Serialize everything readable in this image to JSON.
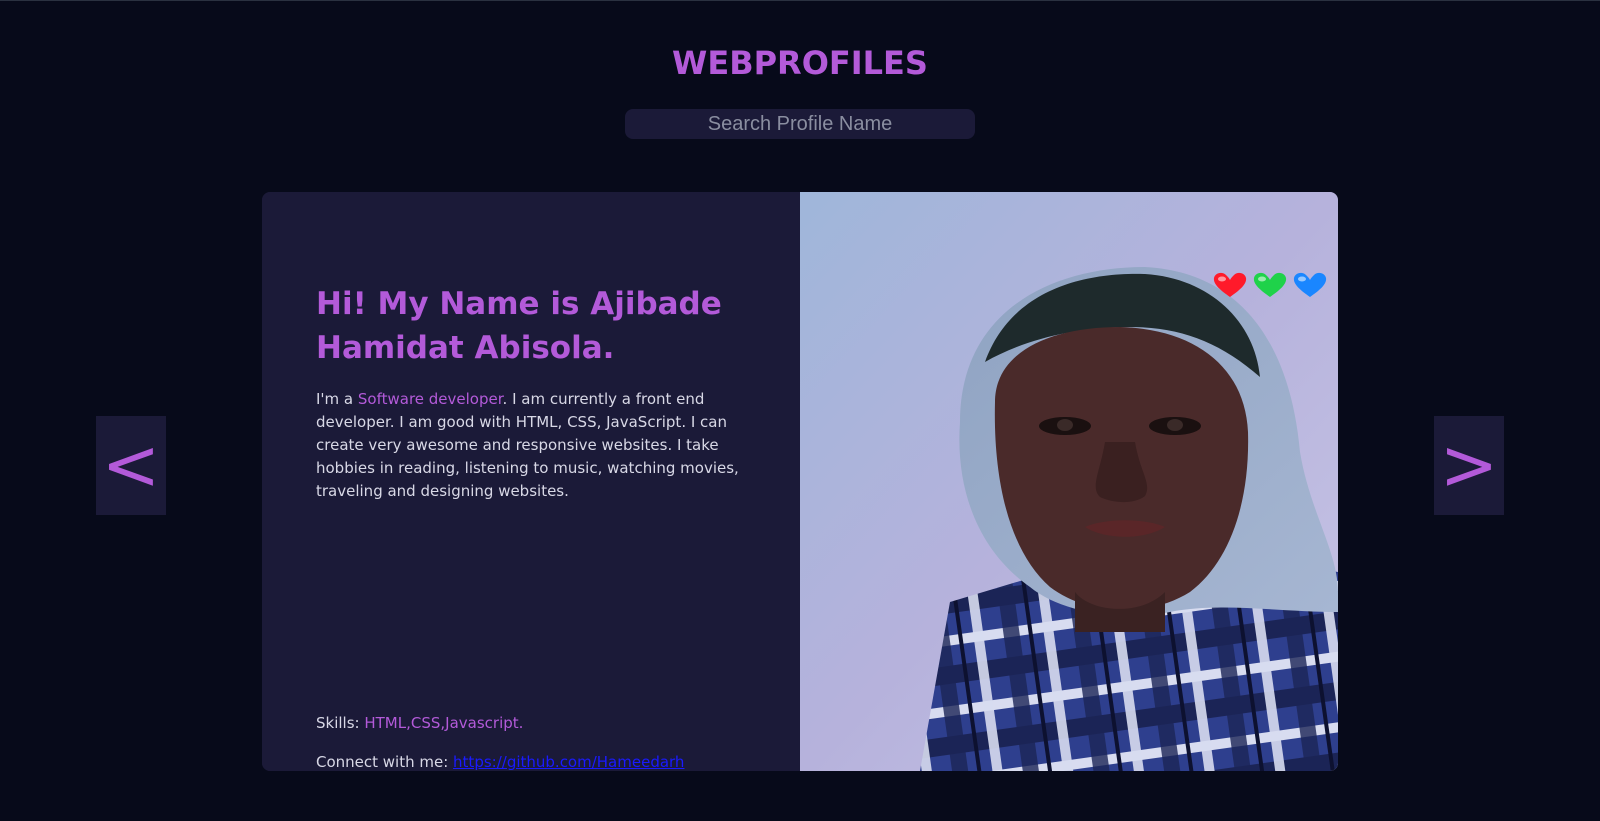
{
  "site": {
    "title": "WEBPROFILES"
  },
  "search": {
    "placeholder": "Search Profile Name",
    "value": ""
  },
  "profile": {
    "heading": "Hi! My Name is Ajibade Hamidat Abisola.",
    "bio_prefix": "I'm a ",
    "role": "Software developer",
    "bio_rest": ". I am currently a front end developer. I am good with HTML, CSS, JavaScript. I can create very awesome and responsive websites. I take hobbies in reading, listening to music, watching movies, traveling and designing websites.",
    "skills_label": "Skills: ",
    "skills_value": "HTML,CSS,Javascript.",
    "connect_label": "Connect with me: ",
    "connect_link": "https://github.com/Hameedarh",
    "photo_icon": "profile-photo"
  },
  "nav": {
    "prev_label": "<",
    "next_label": ">"
  },
  "colors": {
    "background": "#070a1a",
    "card": "#1b1a38",
    "accent": "#b35ad9",
    "link": "#1a1aff",
    "heart_red": "#ff1a2a",
    "heart_green": "#1fd24a",
    "heart_blue": "#1a86ff"
  }
}
